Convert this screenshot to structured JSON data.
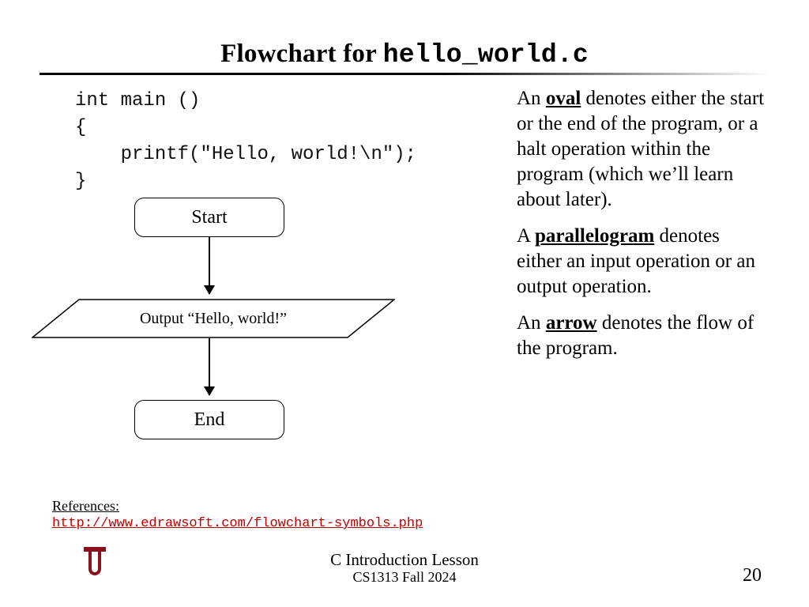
{
  "title": {
    "prefix": "Flowchart for ",
    "mono": "hello_world.c"
  },
  "code": "int main ()\n{\n    printf(\"Hello, world!\\n\");\n}",
  "flow": {
    "start": "Start",
    "io": "Output “Hello, world!”",
    "end": "End"
  },
  "explain": {
    "oval_key": "oval",
    "oval_rest": " denotes either the start or the end of the program, or a halt operation within the program (which we’ll learn about later).",
    "para_key": "parallelogram",
    "para_rest": " denotes either an input operation or an output operation.",
    "arrow_key": "arrow",
    "arrow_rest": " denotes the flow of the program.",
    "an": "An ",
    "a": "A "
  },
  "refs": {
    "label": "References:",
    "url": "http://www.edrawsoft.com/flowchart-symbols.php"
  },
  "footer": {
    "lesson": "C Introduction Lesson",
    "course": "CS1313 Fall 2024",
    "page": "20"
  }
}
